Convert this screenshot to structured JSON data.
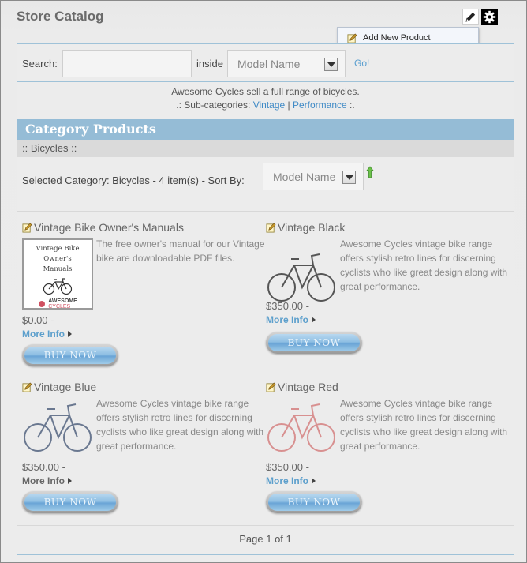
{
  "window": {
    "title": "Store Catalog"
  },
  "tools": {
    "edit_icon": "pencil-icon",
    "settings_icon": "gear-icon"
  },
  "menu": {
    "add_new_product": "Add New Product"
  },
  "search": {
    "label": "Search:",
    "value": "",
    "inside_label": "inside",
    "field_selected": "Model Name",
    "go_label": "Go!"
  },
  "category": {
    "description": "Awesome Cycles sell a full range of bicycles.",
    "subcat_prefix": ".: Sub-categories:",
    "subcategories": [
      "Vintage",
      "Performance"
    ],
    "subcat_separator": "|",
    "subcat_suffix": ":.",
    "header": "Category Products",
    "breadcrumb": ":: Bicycles ::",
    "selected_text": "Selected Category: Bicycles - 4 item(s) - Sort By:",
    "sort_selected": "Model Name"
  },
  "products": [
    {
      "name": "Vintage Bike Owner's Manuals",
      "description": "The free owner's manual for our Vintage bike are downloadable PDF files.",
      "image_text": "Vintage Bike Owner's Manuals",
      "brand_text": "AWESOME",
      "brand_sub": "CYCLES",
      "price": "$0.00 -",
      "more_info": "More Info",
      "buy": "BUY NOW"
    },
    {
      "name": "Vintage Black",
      "description": "Awesome Cycles vintage bike range offers stylish retro lines for discerning cyclists who like great design along with great performance.",
      "price": "$350.00 -",
      "more_info": "More Info",
      "buy": "BUY NOW",
      "color": "#555555"
    },
    {
      "name": "Vintage Blue",
      "description": "Awesome Cycles vintage bike range offers stylish retro lines for discerning cyclists who like great design along with great performance.",
      "price": "$350.00 -",
      "more_info": "More Info",
      "buy": "BUY NOW",
      "color": "#6a7890"
    },
    {
      "name": "Vintage Red",
      "description": "Awesome Cycles vintage bike range offers stylish retro lines for discerning cyclists who like great design along with great performance.",
      "price": "$350.00 -",
      "more_info": "More Info",
      "buy": "BUY NOW",
      "color": "#d89090"
    }
  ],
  "pager": {
    "text": "Page 1 of 1"
  },
  "colors": {
    "accent": "#95bcd6",
    "link": "#3f8ac6"
  }
}
